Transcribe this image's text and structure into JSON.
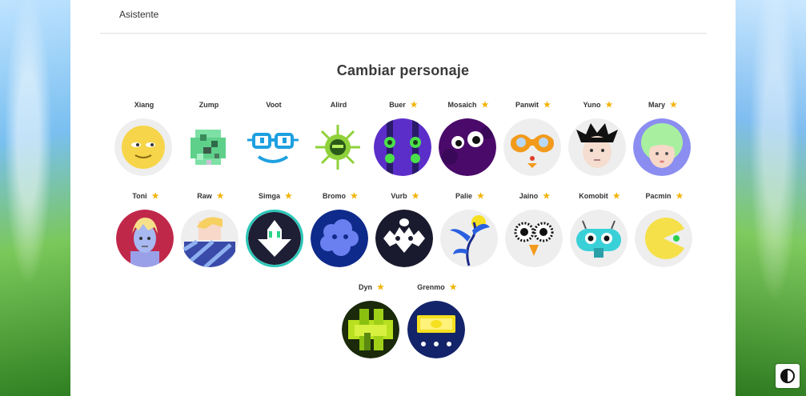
{
  "tabs": {
    "assistant_label": "Asistente"
  },
  "page": {
    "title": "Cambiar personaje"
  },
  "characters": [
    {
      "name": "Xiang",
      "locked": false,
      "icon": "yellow-face-icon"
    },
    {
      "name": "Zump",
      "locked": false,
      "icon": "pixel-green-icon"
    },
    {
      "name": "Voot",
      "locked": false,
      "icon": "glasses-face-icon"
    },
    {
      "name": "Alird",
      "locked": false,
      "icon": "green-virus-icon"
    },
    {
      "name": "Buer",
      "locked": true,
      "icon": "purple-robot-icon"
    },
    {
      "name": "Mosaich",
      "locked": true,
      "icon": "purple-eyes-icon"
    },
    {
      "name": "Panwit",
      "locked": true,
      "icon": "orange-mask-icon"
    },
    {
      "name": "Yuno",
      "locked": true,
      "icon": "black-hair-boy-icon"
    },
    {
      "name": "Mary",
      "locked": true,
      "icon": "green-hair-girl-icon"
    },
    {
      "name": "Toni",
      "locked": true,
      "icon": "blonde-boy-icon"
    },
    {
      "name": "Raw",
      "locked": true,
      "icon": "striped-shirt-icon"
    },
    {
      "name": "Simga",
      "locked": true,
      "icon": "white-arrow-icon",
      "selected": true
    },
    {
      "name": "Bromo",
      "locked": true,
      "icon": "blue-cloud-icon"
    },
    {
      "name": "Vurb",
      "locked": true,
      "icon": "tribal-mask-icon"
    },
    {
      "name": "Palie",
      "locked": true,
      "icon": "blue-flower-icon"
    },
    {
      "name": "Jaino",
      "locked": true,
      "icon": "owl-eyes-icon"
    },
    {
      "name": "Komobit",
      "locked": true,
      "icon": "teal-robot-icon"
    },
    {
      "name": "Pacmin",
      "locked": true,
      "icon": "pacman-icon"
    },
    {
      "name": "Dyn",
      "locked": true,
      "icon": "green-blocks-icon"
    },
    {
      "name": "Grenmo",
      "locked": true,
      "icon": "yellow-screen-icon"
    }
  ],
  "colors": {
    "star": "#f2b200",
    "selected_border": "#2bc7b8"
  }
}
